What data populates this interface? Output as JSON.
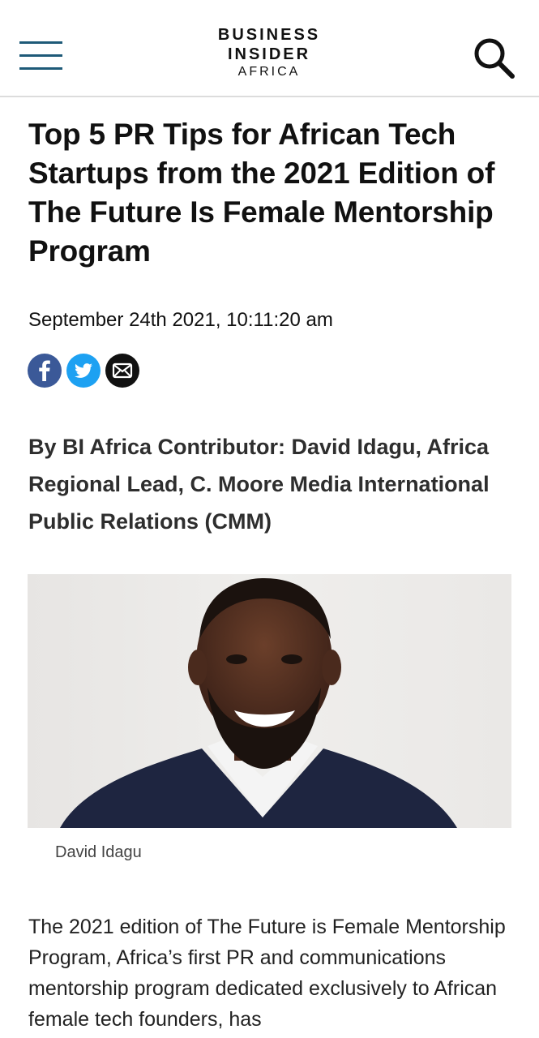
{
  "header": {
    "logo_line1": "BUSINESS",
    "logo_line2": "INSIDER",
    "logo_line3": "AFRICA",
    "menu_icon": "hamburger-menu-icon",
    "search_icon": "search-icon",
    "accent_color": "#1e5a78"
  },
  "article": {
    "title": "Top 5 PR Tips for African Tech Startups from the 2021 Edition of The Future Is Female Mentorship Program",
    "date": "September 24th 2021, 10:11:20 am",
    "share": [
      {
        "icon": "facebook-icon",
        "color": "#3b5998"
      },
      {
        "icon": "twitter-icon",
        "color": "#1da1f2"
      },
      {
        "icon": "email-icon",
        "color": "#111111"
      }
    ],
    "byline": "By BI Africa Contributor: David Idagu, Africa Regional Lead, C. Moore Media International Public Relations (CMM)",
    "image_caption": "David Idagu",
    "body_preview": "The 2021 edition of The Future is Female Mentorship Program, Africa’s first PR and communications mentorship program dedicated exclusively to African female tech founders, has"
  }
}
